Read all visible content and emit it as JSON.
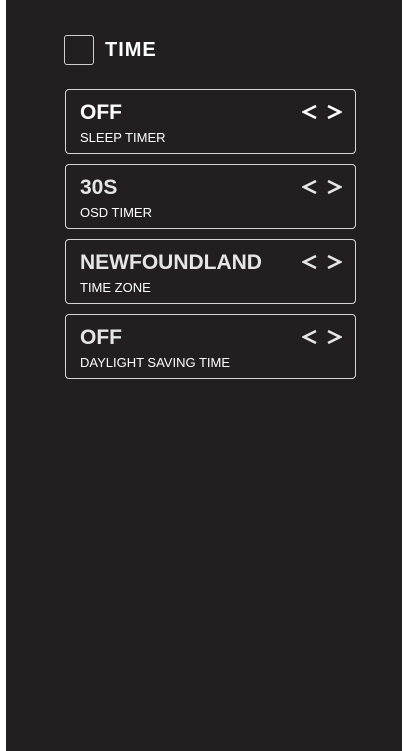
{
  "header": {
    "title": "TIME",
    "icon": "checkbox-square-icon"
  },
  "settings": [
    {
      "value": "OFF",
      "label": "SLEEP TIMER"
    },
    {
      "value": "30S",
      "label": "OSD TIMER"
    },
    {
      "value": "NEWFOUNDLAND",
      "label": "TIME ZONE"
    },
    {
      "value": "OFF",
      "label": "DAYLIGHT SAVING TIME"
    }
  ],
  "colors": {
    "background": "#231f20",
    "text": "#ffffff",
    "border": "#d6d6d6"
  }
}
